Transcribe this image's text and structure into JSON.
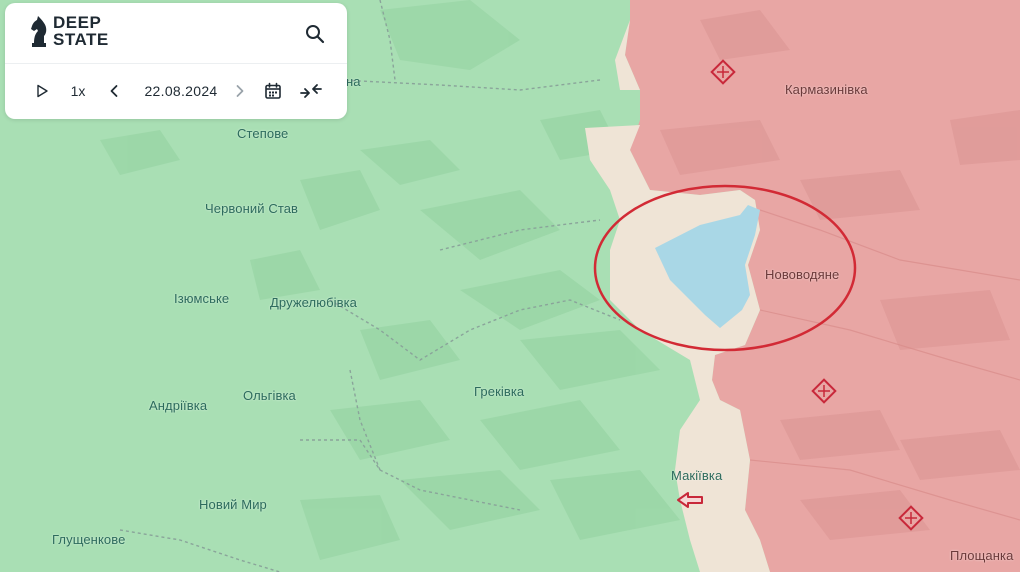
{
  "app": {
    "logo_line1": "DEEP",
    "logo_line2": "STATE"
  },
  "toolbar": {
    "play_icon": "play-icon",
    "speed": "1x",
    "prev_icon": "chevron-left-icon",
    "date": "22.08.2024",
    "next_icon": "chevron-right-icon",
    "calendar_icon": "calendar-icon",
    "collapse_icon": "collapse-arrows-icon",
    "search_icon": "search-icon"
  },
  "map": {
    "colors": {
      "controlled": "#a9dfb4",
      "occupied": "#e8a6a4",
      "contested": "#efe4d6",
      "water": "#a9d7e6",
      "highlight_circle": "#d22a35"
    },
    "places": {
      "karmazynivka": "Кармазинівка",
      "novovodiane": "Нововодяне",
      "stepove": "Степове",
      "chervonyi_stav": "Червоний Став",
      "izyumske": "Ізюмське",
      "druzheliubivka": "Дружелюбівка",
      "hrekivka": "Греківка",
      "andriivka": "Андріївка",
      "olhivka": "Ольгівка",
      "makiivka": "Макіївка",
      "novyi_myr": "Новий Мир",
      "hlushchenkove": "Глущенкове",
      "ploshchanka": "Площанка",
      "partial_top": "на"
    },
    "markers": [
      "attack-marker-icon",
      "attack-marker-icon",
      "attack-marker-icon",
      "direction-arrow-icon"
    ]
  }
}
